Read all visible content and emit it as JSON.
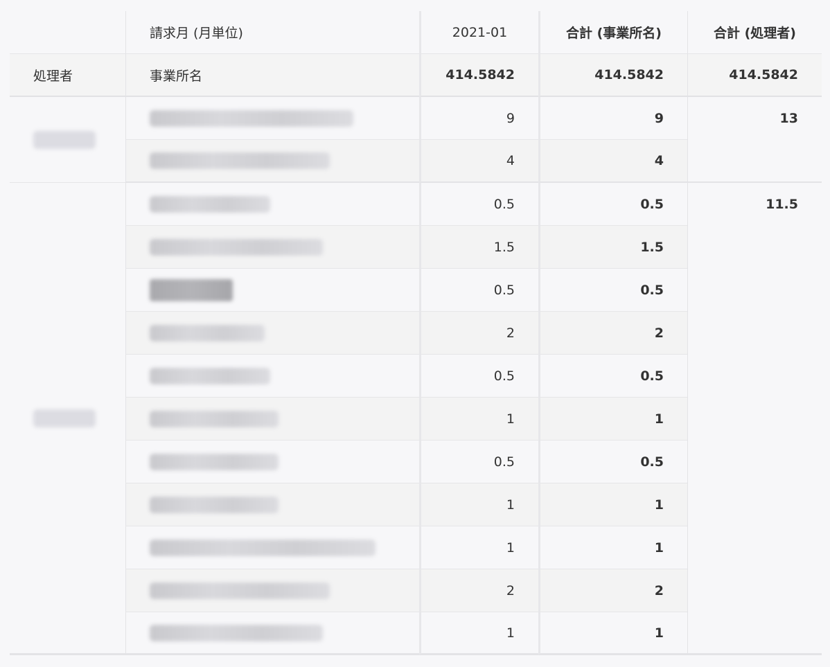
{
  "header": {
    "col_field_label": "請求月 (月単位)",
    "col_month": "2021-01",
    "col_total_office": "合計 (事業所名)",
    "col_total_processor": "合計 (処理者)"
  },
  "subheader": {
    "processor_label": "処理者",
    "office_label": "事業所名",
    "grand_month": "414.5842",
    "grand_office": "414.5842",
    "grand_processor": "414.5842"
  },
  "groups": [
    {
      "processor_total": "13",
      "rows": [
        {
          "month": "9",
          "office_total": "9"
        },
        {
          "month": "4",
          "office_total": "4"
        }
      ]
    },
    {
      "processor_total": "11.5",
      "rows": [
        {
          "month": "0.5",
          "office_total": "0.5"
        },
        {
          "month": "1.5",
          "office_total": "1.5"
        },
        {
          "month": "0.5",
          "office_total": "0.5"
        },
        {
          "month": "2",
          "office_total": "2"
        },
        {
          "month": "0.5",
          "office_total": "0.5"
        },
        {
          "month": "1",
          "office_total": "1"
        },
        {
          "month": "0.5",
          "office_total": "0.5"
        },
        {
          "month": "1",
          "office_total": "1"
        },
        {
          "month": "1",
          "office_total": "1"
        },
        {
          "month": "2",
          "office_total": "2"
        },
        {
          "month": "1",
          "office_total": "1"
        }
      ]
    }
  ]
}
